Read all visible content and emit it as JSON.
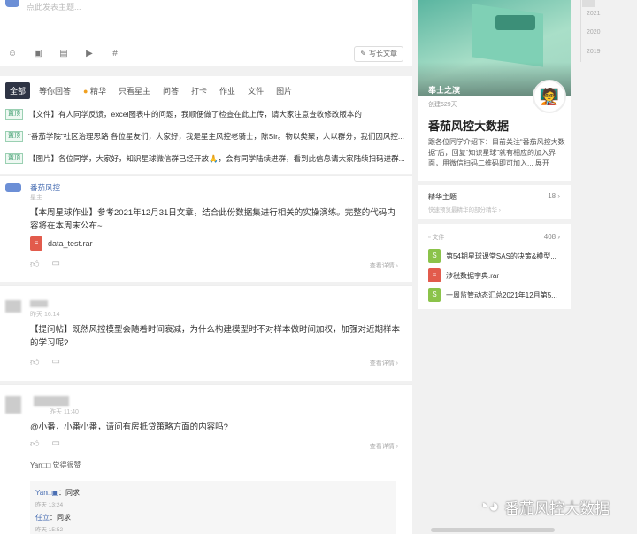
{
  "composer": {
    "placeholder": "点此发表主题...",
    "long_article": "写长文章",
    "tools": [
      "emoji-icon",
      "image-icon",
      "file-icon",
      "video-icon",
      "hashtag-icon"
    ]
  },
  "tabs": [
    "全部",
    "等你回答",
    "精华",
    "只看星主",
    "问答",
    "打卡",
    "作业",
    "文件",
    "图片"
  ],
  "notices": [
    {
      "tag": "置顶",
      "text": "【文件】有人同学反馈，excel图表中的问题，我顺便做了检查在此上传，请大家注意查收修改版本的"
    },
    {
      "tag": "置顶",
      "text": "“番茄学院”社区治理思路 各位星友们，大家好，我是星主风控老骑士，陈Sir。物以类聚，人以群分，我们因风控..."
    },
    {
      "tag": "置顶",
      "text": "【图片】各位同学，大家好，知识星球微信群已经开放🙏，会有同学陆续进群，看到此信息请大家陆续扫码进群..."
    }
  ],
  "post1": {
    "author": "番茄风控",
    "role": "星主",
    "body": "【本周星球作业】参考2021年12月31日文章，结合此份数据集进行相关的实操演练。完整的代码内容将在本周末公布~",
    "file": "data_test.rar",
    "more": "查看详情 ›"
  },
  "post2": {
    "time": "昨天 16:14",
    "body": "【提问帖】既然风控模型会随着时间衰减，为什么构建模型时不对样本做时间加权，加强对近期样本的学习呢?",
    "more": "查看详情 ›"
  },
  "post3": {
    "time": "昨天 11:40",
    "body": "@小番，小番小番，请问有房抵贷策略方面的内容吗?",
    "more": "查看详情 ›",
    "likes": "Yan□□ 觉得很赞",
    "replies": [
      {
        "name": "Yan□▣",
        "text": "：同求",
        "time": "昨天 13:24"
      },
      {
        "name": "任立",
        "text": "：同求",
        "time": "昨天 15:52"
      }
    ]
  },
  "group": {
    "owner": "奉士之滨",
    "created": "创建529天",
    "name": "番茄风控大数据",
    "desc": "跟各位同学介绍下：目前关注“番茄风控大数据”后，回复“知识星球”就有相应的加入界面，用微信扫码二维码即可加入... 展开"
  },
  "featured": {
    "title": "精华主题",
    "count": "18 ›",
    "sub": "快速预览最精华的部分精华 ›"
  },
  "files": {
    "title": "文件",
    "count": "408 ›",
    "items": [
      {
        "icon": "green",
        "name": "第54期星球课堂SAS的决策&模型..."
      },
      {
        "icon": "red",
        "name": "涉税数据字典.rar"
      },
      {
        "icon": "green",
        "name": "一周监管动态汇总2021年12月第5..."
      }
    ]
  },
  "years": [
    "2021",
    "2020",
    "2019"
  ],
  "watermark": "番茄风控大数据"
}
